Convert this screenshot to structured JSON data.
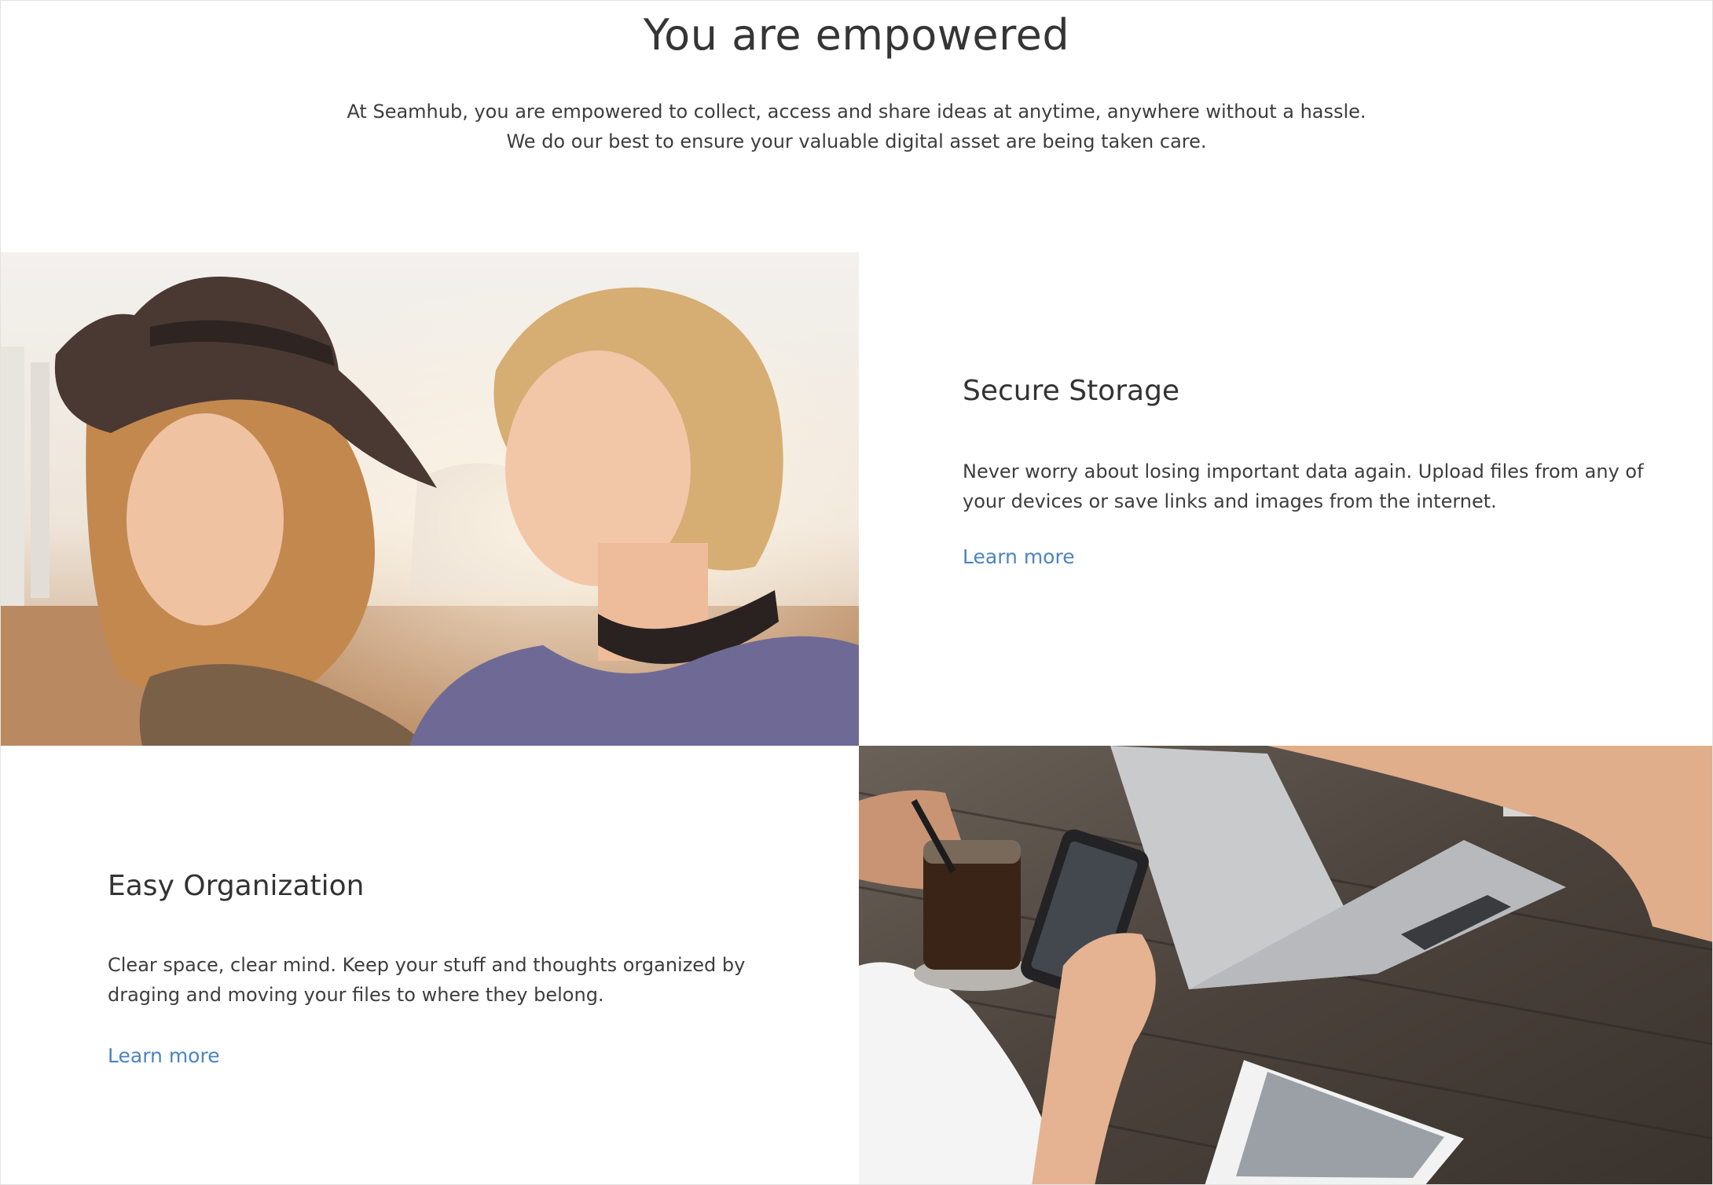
{
  "hero": {
    "title": "You are empowered",
    "subtitle_line1": "At Seamhub, you are empowered to collect, access and share ideas at anytime, anywhere without a hassle.",
    "subtitle_line2": "We do our best to ensure your valuable digital asset are being taken care."
  },
  "features": [
    {
      "title": "Secure Storage",
      "text": "Never worry about losing important data again. Upload files from any of your devices or save links and images from the internet.",
      "link": "Learn more"
    },
    {
      "title": "Easy Organization",
      "text": "Clear space, clear mind. Keep your stuff and thoughts organized by draging and moving your files to where they belong.",
      "link": "Learn more"
    }
  ],
  "colors": {
    "link": "#4b84c0",
    "heading": "#333333",
    "text": "#3d3d3d"
  }
}
